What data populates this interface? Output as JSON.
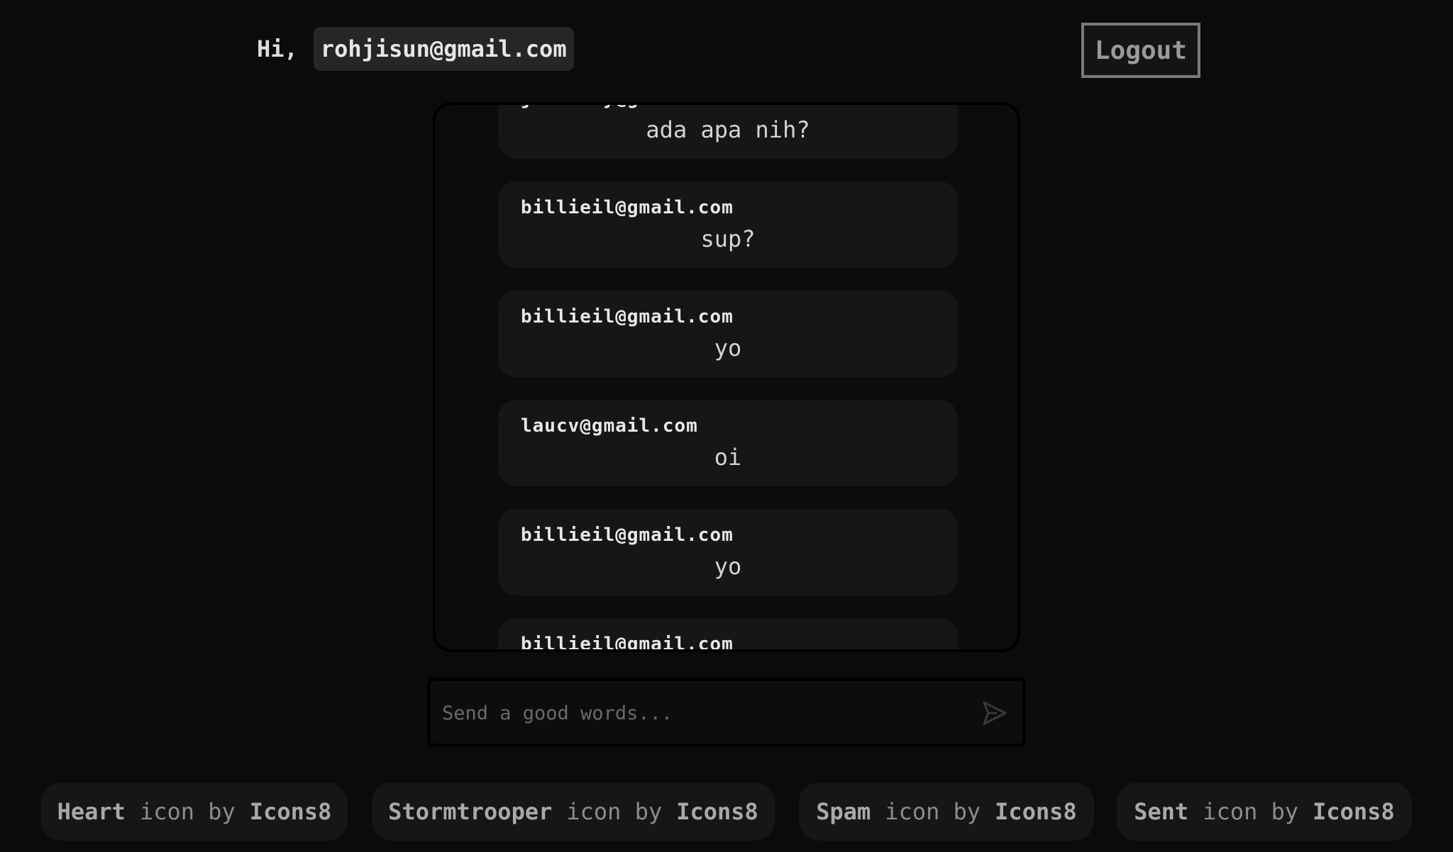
{
  "header": {
    "greeting": "Hi,",
    "user_email": "rohjisun@gmail.com",
    "logout_label": "Logout"
  },
  "messages": [
    {
      "sender": "jamesbay@gmail.com",
      "text": "ada apa nih?"
    },
    {
      "sender": "billieil@gmail.com",
      "text": "sup?"
    },
    {
      "sender": "billieil@gmail.com",
      "text": "yo"
    },
    {
      "sender": "laucv@gmail.com",
      "text": "oi"
    },
    {
      "sender": "billieil@gmail.com",
      "text": "yo"
    },
    {
      "sender": "billieil@gmail.com",
      "text": ""
    }
  ],
  "composer": {
    "placeholder": "Send a good words...",
    "send_icon": "sent-icon"
  },
  "credits": [
    {
      "name": "Heart",
      "middle": "icon by",
      "author": "Icons8"
    },
    {
      "name": "Stormtrooper",
      "middle": "icon by",
      "author": "Icons8"
    },
    {
      "name": "Spam",
      "middle": "icon by",
      "author": "Icons8"
    },
    {
      "name": "Sent",
      "middle": "icon by",
      "author": "Icons8"
    }
  ],
  "colors": {
    "background": "#0b0b0b",
    "card": "#161616",
    "chip": "#262626",
    "logout_border": "#7a7a7a"
  }
}
